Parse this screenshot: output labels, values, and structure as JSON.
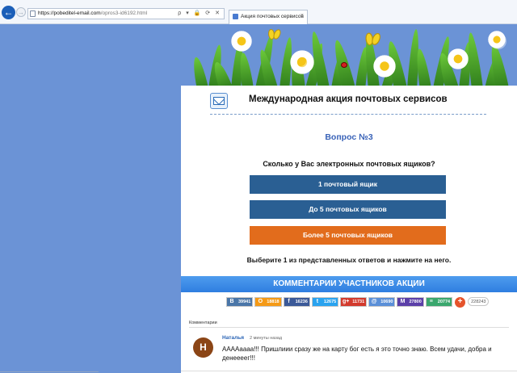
{
  "browser": {
    "url_host": "https://pobeditel-email.com",
    "url_path": "/opros3-id6192.html",
    "address_icons": "ρ ▾ 🔒 ⟳ ✕",
    "tab_title": "Акция почтовых сервисов",
    "tab_close": "×",
    "back_label": "←",
    "forward_label": "→"
  },
  "panel": {
    "title": "Международная акция почтовых сервисов",
    "question_number": "Вопрос №3",
    "question_text": "Сколько у Вас электронных почтовых ящиков?",
    "answers": [
      {
        "label": "1 почтовый ящик"
      },
      {
        "label": "До 5 почтовых ящиков"
      },
      {
        "label": "Более 5 почтовых ящиков"
      }
    ],
    "hint": "Выберите 1 из представленных ответов и нажмите на него."
  },
  "comments_bar": {
    "title": "КОММЕНТАРИИ УЧАСТНИКОВ АКЦИИ"
  },
  "share": {
    "buttons": [
      {
        "icon": "В",
        "count": "39941",
        "color": "#4a76a8"
      },
      {
        "icon": "О",
        "count": "18818",
        "color": "#f59a16"
      },
      {
        "icon": "f",
        "count": "16236",
        "color": "#3b5998"
      },
      {
        "icon": "t",
        "count": "12675",
        "color": "#2aa3ef"
      },
      {
        "icon": "g+",
        "count": "11731",
        "color": "#d23a2d"
      },
      {
        "icon": "@",
        "count": "10690",
        "color": "#5a8fd8"
      },
      {
        "icon": "M",
        "count": "27800",
        "color": "#5b3fa8"
      },
      {
        "icon": "≡",
        "count": "20774",
        "color": "#3aa76d"
      }
    ],
    "plus": "+",
    "total": "228243"
  },
  "comments": {
    "label": "Комментарии",
    "items": [
      {
        "avatar_letter": "Н",
        "author": "Наталья",
        "time": "2 минуты назад",
        "text": "ААААаааа!!! Пришлиии сразу же на карту бог есть я это точно знаю. Всем удачи, добра и денеееег!!!"
      }
    ]
  },
  "colors": {
    "background": "#6b93d6",
    "answer_blue": "#2a5f93",
    "answer_orange": "#e26c1c",
    "accent": "#3a63b8"
  }
}
